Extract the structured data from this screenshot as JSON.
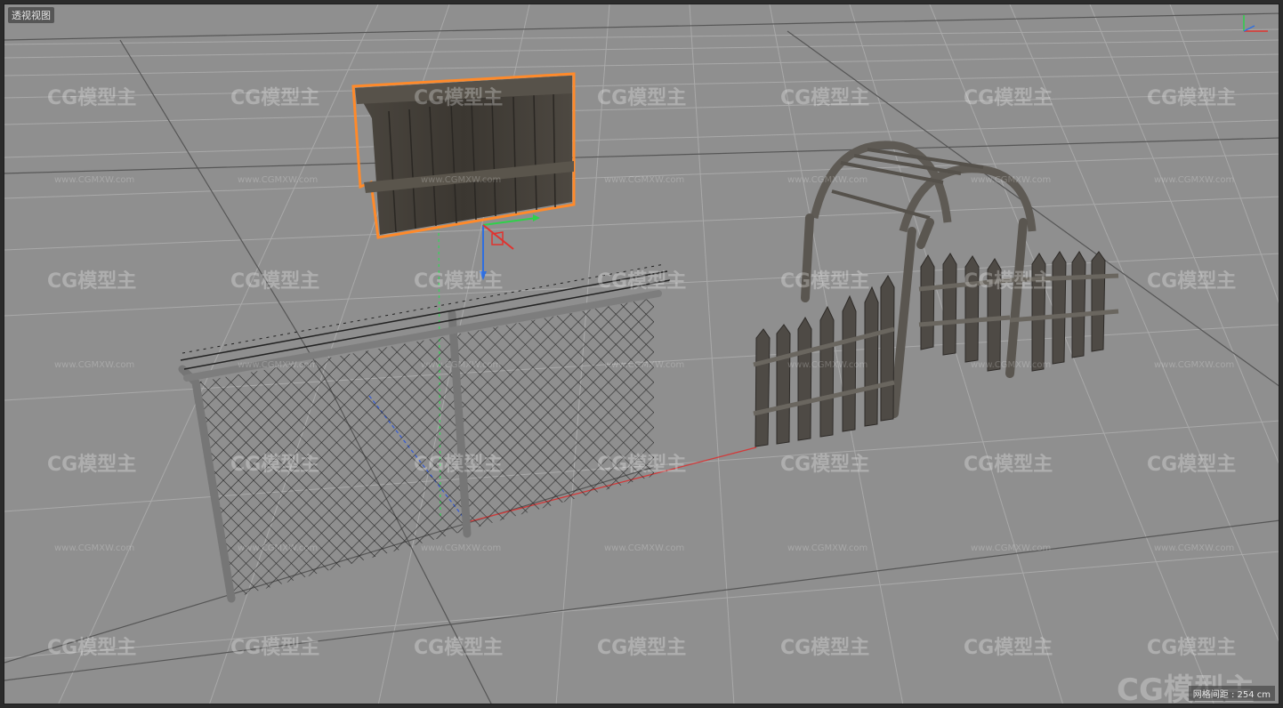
{
  "viewport": {
    "label": "透视视图",
    "grid_spacing_label": "网格间距 : 254 cm"
  },
  "watermark": {
    "brand": "CG模型主",
    "url": "www.CGMXW.com"
  },
  "axis_colors": {
    "x": "#e0332f",
    "y": "#2fd14a",
    "z": "#2f6fe0"
  },
  "selection_color": "#ff8a2a",
  "objects": [
    {
      "name": "wooden-board-fence",
      "selected": true
    },
    {
      "name": "chain-link-fence",
      "selected": false
    },
    {
      "name": "picket-fence-arch",
      "selected": false
    }
  ]
}
